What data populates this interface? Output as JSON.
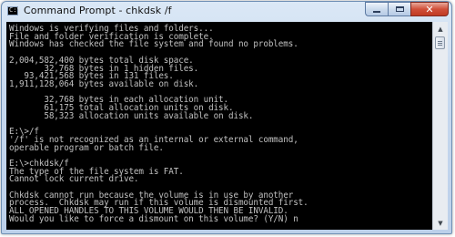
{
  "window": {
    "title": "Command Prompt - chkdsk /f",
    "app_icon_label": "C:\\",
    "icons": {
      "minimize": "minimize-icon",
      "maximize": "maximize-icon",
      "close": "close-icon"
    },
    "close_glyph": "✕",
    "colors": {
      "console_bg": "#000000",
      "console_text": "#c0c0c0",
      "close_red": "#c9432b"
    }
  },
  "console": {
    "lines": [
      "Windows is verifying files and folders...",
      "File and folder verification is complete.",
      "Windows has checked the file system and found no problems.",
      "",
      "2,004,582,400 bytes total disk space.",
      "       32,768 bytes in 1 hidden files.",
      "   93,421,568 bytes in 131 files.",
      "1,911,128,064 bytes available on disk.",
      "",
      "       32,768 bytes in each allocation unit.",
      "       61,175 total allocation units on disk.",
      "       58,323 allocation units available on disk.",
      "",
      "E:\\>/f",
      "'/f' is not recognized as an internal or external command,",
      "operable program or batch file.",
      "",
      "E:\\>chkdsk/f",
      "The type of the file system is FAT.",
      "Cannot lock current drive.",
      "",
      "Chkdsk cannot run because the volume is in use by another",
      "process.  Chkdsk may run if this volume is dismounted first.",
      "ALL OPENED HANDLES TO THIS VOLUME WOULD THEN BE INVALID.",
      "Would you like to force a dismount on this volume? (Y/N) n"
    ]
  },
  "scrollbar": {
    "up_arrow": "▲",
    "down_arrow": "▼"
  }
}
